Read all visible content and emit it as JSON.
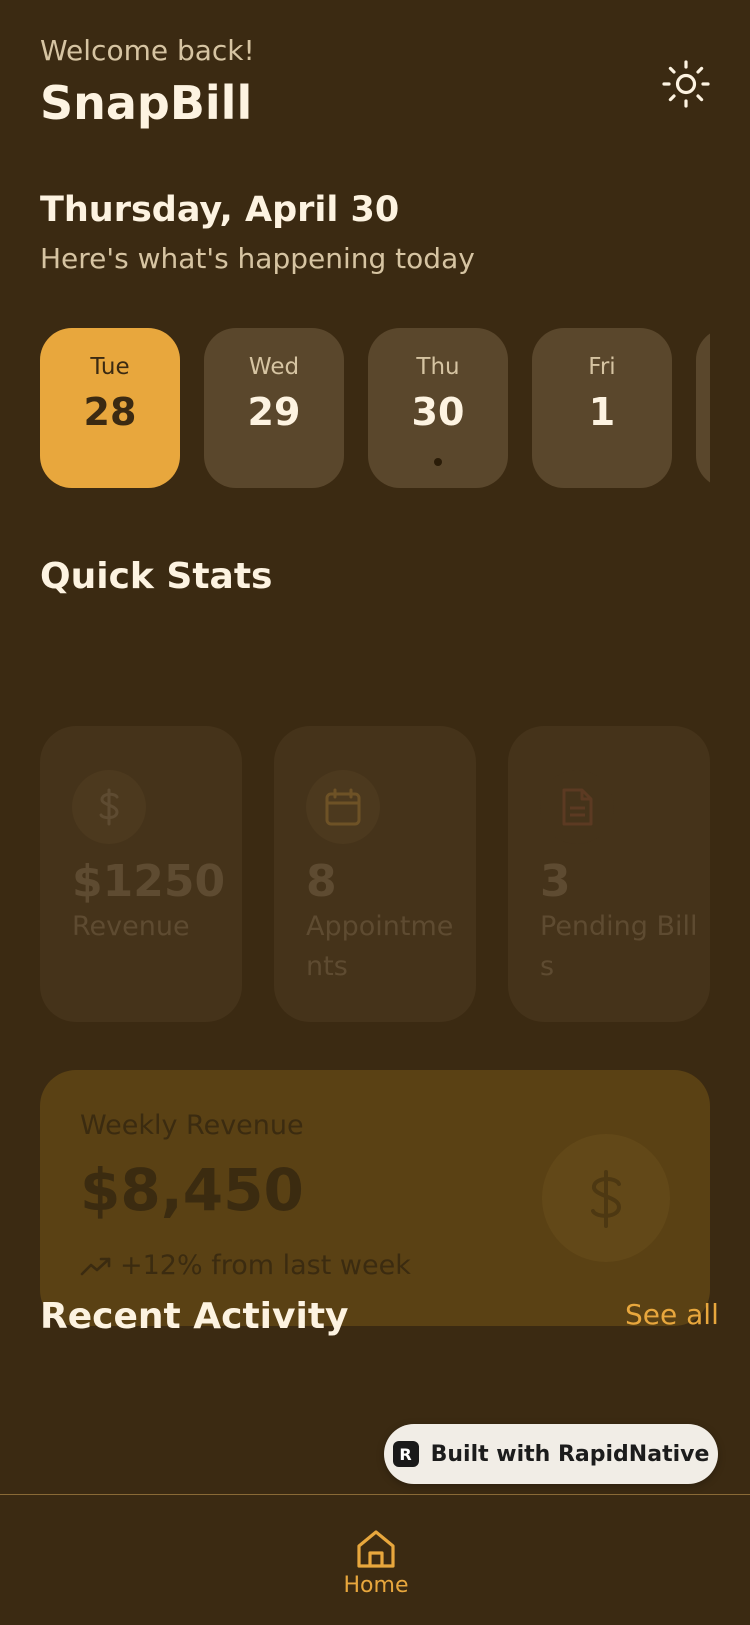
{
  "header": {
    "welcome": "Welcome back!",
    "app_title": "SnapBill",
    "theme_icon": "sun-icon"
  },
  "date": {
    "heading": "Thursday, April 30",
    "subheading": "Here's what's happening today"
  },
  "days": [
    {
      "name": "Tue",
      "num": "28",
      "selected": true
    },
    {
      "name": "Wed",
      "num": "29"
    },
    {
      "name": "Thu",
      "num": "30",
      "today": true
    },
    {
      "name": "Fri",
      "num": "1"
    },
    {
      "name": "",
      "num": ""
    }
  ],
  "quick_stats": {
    "title": "Quick Stats",
    "cards": [
      {
        "icon": "dollar-icon",
        "value": "$1250",
        "label": "Revenue"
      },
      {
        "icon": "calendar-icon",
        "value": "8",
        "label": "Appointments"
      },
      {
        "icon": "document-icon",
        "value": "3",
        "label": "Pending Bills"
      }
    ]
  },
  "weekly": {
    "label": "Weekly Revenue",
    "value": "$8,450",
    "change": "+12% from last week",
    "trend_icon": "trending-up-icon",
    "coin_icon": "dollar-icon"
  },
  "activity": {
    "title": "Recent Activity",
    "see_all": "See all"
  },
  "badge": {
    "text": "Built with RapidNative",
    "logo": "R"
  },
  "tabbar": {
    "home_label": "Home",
    "home_icon": "home-icon"
  },
  "colors": {
    "background": "#3b2a12",
    "accent": "#e8a73d",
    "card": "#5a472c"
  }
}
